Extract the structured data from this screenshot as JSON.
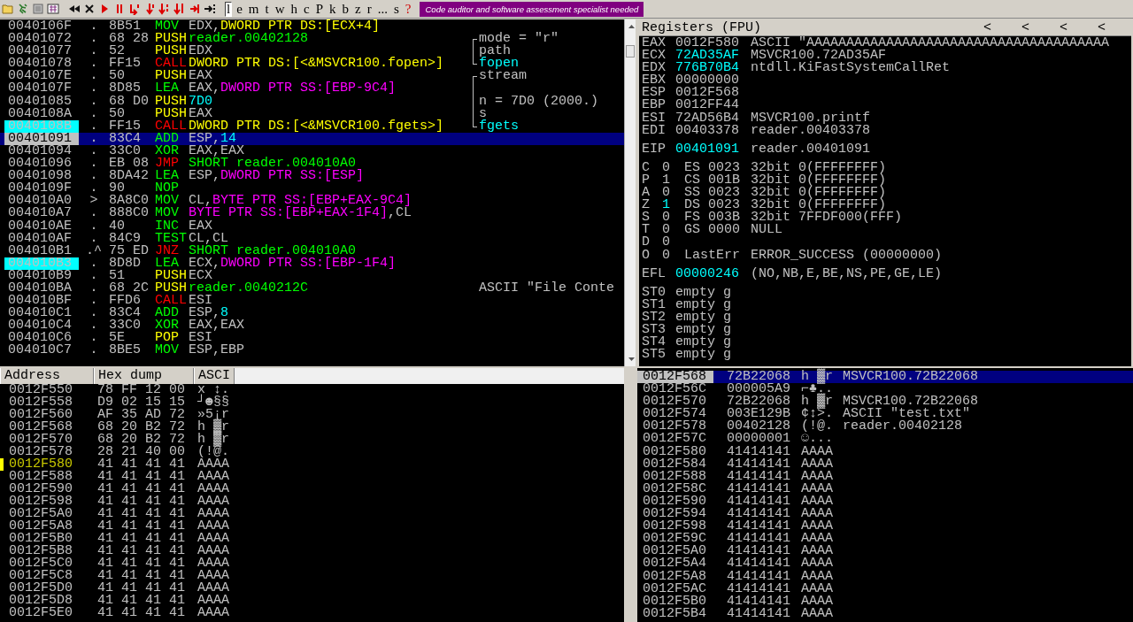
{
  "toolbar": {
    "window_buttons": [
      {
        "label": "l",
        "selected": true
      },
      {
        "label": "e",
        "selected": false
      },
      {
        "label": "m",
        "selected": false
      },
      {
        "label": "t",
        "selected": false
      },
      {
        "label": "w",
        "selected": false
      },
      {
        "label": "h",
        "selected": false
      },
      {
        "label": "c",
        "selected": false
      },
      {
        "label": "P",
        "selected": false
      },
      {
        "label": "k",
        "selected": false
      },
      {
        "label": "b",
        "selected": false
      },
      {
        "label": "z",
        "selected": false
      },
      {
        "label": "r",
        "selected": false
      },
      {
        "label": "...",
        "selected": false
      },
      {
        "label": "s",
        "selected": false
      }
    ],
    "help_button": "?",
    "banner": "Code auditor and software assessment specialist needed"
  },
  "disassembly": {
    "rows": [
      {
        "address": "0040106F",
        "mark": ".",
        "bytes": "8B51",
        "mnemonic": "MOV",
        "kind": "data",
        "operands": [
          {
            "text": "EDX,",
            "kind": "plain"
          },
          {
            "text": "DWORD PTR DS:[ECX+4]",
            "kind": "ds"
          }
        ],
        "marked": false,
        "selected": false
      },
      {
        "address": "00401072",
        "mark": ".",
        "bytes": "68 28",
        "mnemonic": "PUSH",
        "kind": "stack",
        "operands": [
          {
            "text": "reader.00402128",
            "kind": "addr"
          }
        ],
        "comment": {
          "text": "mode = \"r\"",
          "kind": "first_arg"
        },
        "marked": false,
        "selected": false
      },
      {
        "address": "00401077",
        "mark": ".",
        "bytes": "52",
        "mnemonic": "PUSH",
        "kind": "stack",
        "operands": [
          {
            "text": "EDX",
            "kind": "plain"
          }
        ],
        "comment": {
          "text": "path",
          "kind": "arg"
        },
        "marked": false,
        "selected": false
      },
      {
        "address": "00401078",
        "mark": ".",
        "bytes": "FF15",
        "mnemonic": "CALL",
        "kind": "flow",
        "operands": [
          {
            "text": "DWORD PTR DS:[<&MSVCR100.fopen>]",
            "kind": "ds"
          }
        ],
        "comment": {
          "text": "fopen",
          "kind": "call"
        },
        "marked": false,
        "selected": false
      },
      {
        "address": "0040107E",
        "mark": ".",
        "bytes": "50",
        "mnemonic": "PUSH",
        "kind": "stack",
        "operands": [
          {
            "text": "EAX",
            "kind": "plain"
          }
        ],
        "comment": {
          "text": "stream",
          "kind": "first_arg"
        },
        "marked": false,
        "selected": false
      },
      {
        "address": "0040107F",
        "mark": ".",
        "bytes": "8D85",
        "mnemonic": "LEA",
        "kind": "data",
        "operands": [
          {
            "text": "EAX,",
            "kind": "plain"
          },
          {
            "text": "DWORD PTR SS:[EBP-9C4]",
            "kind": "ss"
          }
        ],
        "comment": {
          "kind": "arg"
        },
        "marked": false,
        "selected": false
      },
      {
        "address": "00401085",
        "mark": ".",
        "bytes": "68 D0",
        "mnemonic": "PUSH",
        "kind": "stack",
        "operands": [
          {
            "text": "7D0",
            "kind": "num"
          }
        ],
        "comment": {
          "text": "n = 7D0 (2000.)",
          "kind": "arg"
        },
        "marked": false,
        "selected": false
      },
      {
        "address": "0040108A",
        "mark": ".",
        "bytes": "50",
        "mnemonic": "PUSH",
        "kind": "stack",
        "operands": [
          {
            "text": "EAX",
            "kind": "plain"
          }
        ],
        "comment": {
          "text": "s",
          "kind": "arg"
        },
        "marked": false,
        "selected": false
      },
      {
        "address": "0040108B",
        "mark": ".",
        "bytes": "FF15",
        "mnemonic": "CALL",
        "kind": "flow",
        "operands": [
          {
            "text": "DWORD PTR DS:[<&MSVCR100.fgets>]",
            "kind": "ds"
          }
        ],
        "comment": {
          "text": "fgets",
          "kind": "call"
        },
        "marked": true,
        "selected": false
      },
      {
        "address": "00401091",
        "mark": ".",
        "bytes": "83C4",
        "mnemonic": "ADD",
        "kind": "data",
        "operands": [
          {
            "text": "ESP,",
            "kind": "plain"
          },
          {
            "text": "14",
            "kind": "num"
          }
        ],
        "marked": false,
        "selected": true
      },
      {
        "address": "00401094",
        "mark": ".",
        "bytes": "33C0",
        "mnemonic": "XOR",
        "kind": "data",
        "operands": [
          {
            "text": "EAX,EAX",
            "kind": "plain"
          }
        ],
        "marked": false,
        "selected": false
      },
      {
        "address": "00401096",
        "mark": ".",
        "bytes": "EB 08",
        "mnemonic": "JMP",
        "kind": "flow",
        "operands": [
          {
            "text": "SHORT reader.004010A0",
            "kind": "addr"
          }
        ],
        "marked": false,
        "selected": false
      },
      {
        "address": "00401098",
        "mark": ".",
        "bytes": "8DA42",
        "mnemonic": "LEA",
        "kind": "data",
        "operands": [
          {
            "text": "ESP,",
            "kind": "plain"
          },
          {
            "text": "DWORD PTR SS:[ESP]",
            "kind": "ss"
          }
        ],
        "marked": false,
        "selected": false
      },
      {
        "address": "0040109F",
        "mark": ".",
        "bytes": "90",
        "mnemonic": "NOP",
        "kind": "data",
        "operands": [],
        "marked": false,
        "selected": false
      },
      {
        "address": "004010A0",
        "mark": ">",
        "bytes": "8A8C0",
        "mnemonic": "MOV",
        "kind": "data",
        "operands": [
          {
            "text": "CL,",
            "kind": "plain"
          },
          {
            "text": "BYTE PTR SS:[EBP+EAX-9C4]",
            "kind": "ss"
          }
        ],
        "marked": false,
        "selected": false
      },
      {
        "address": "004010A7",
        "mark": ".",
        "bytes": "888C0",
        "mnemonic": "MOV",
        "kind": "data",
        "operands": [
          {
            "text": "BYTE PTR SS:[EBP+EAX-1F4]",
            "kind": "ss"
          },
          {
            "text": ",CL",
            "kind": "plain"
          }
        ],
        "marked": false,
        "selected": false
      },
      {
        "address": "004010AE",
        "mark": ".",
        "bytes": "40",
        "mnemonic": "INC",
        "kind": "data",
        "operands": [
          {
            "text": "EAX",
            "kind": "plain"
          }
        ],
        "marked": false,
        "selected": false
      },
      {
        "address": "004010AF",
        "mark": ".",
        "bytes": "84C9",
        "mnemonic": "TEST",
        "kind": "data",
        "operands": [
          {
            "text": "CL,CL",
            "kind": "plain"
          }
        ],
        "marked": false,
        "selected": false
      },
      {
        "address": "004010B1",
        "mark": ".^",
        "bytes": "75 ED",
        "mnemonic": "JNZ",
        "kind": "flow",
        "operands": [
          {
            "text": "SHORT reader.004010A0",
            "kind": "addr"
          }
        ],
        "marked": false,
        "selected": false
      },
      {
        "address": "004010B3",
        "mark": ".",
        "bytes": "8D8D",
        "mnemonic": "LEA",
        "kind": "data",
        "operands": [
          {
            "text": "ECX,",
            "kind": "plain"
          },
          {
            "text": "DWORD PTR SS:[EBP-1F4]",
            "kind": "ss"
          }
        ],
        "marked": true,
        "selected": false
      },
      {
        "address": "004010B9",
        "mark": ".",
        "bytes": "51",
        "mnemonic": "PUSH",
        "kind": "stack",
        "operands": [
          {
            "text": "ECX",
            "kind": "plain"
          }
        ],
        "marked": false,
        "selected": false
      },
      {
        "address": "004010BA",
        "mark": ".",
        "bytes": "68 2C",
        "mnemonic": "PUSH",
        "kind": "stack",
        "operands": [
          {
            "text": "reader.0040212C",
            "kind": "addr"
          }
        ],
        "comment": {
          "text": "ASCII \"File Conte",
          "kind": "note"
        },
        "marked": false,
        "selected": false
      },
      {
        "address": "004010BF",
        "mark": ".",
        "bytes": "FFD6",
        "mnemonic": "CALL",
        "kind": "flow",
        "operands": [
          {
            "text": "ESI",
            "kind": "plain"
          }
        ],
        "marked": false,
        "selected": false
      },
      {
        "address": "004010C1",
        "mark": ".",
        "bytes": "83C4",
        "mnemonic": "ADD",
        "kind": "data",
        "operands": [
          {
            "text": "ESP,",
            "kind": "plain"
          },
          {
            "text": "8",
            "kind": "num"
          }
        ],
        "marked": false,
        "selected": false
      },
      {
        "address": "004010C4",
        "mark": ".",
        "bytes": "33C0",
        "mnemonic": "XOR",
        "kind": "data",
        "operands": [
          {
            "text": "EAX,EAX",
            "kind": "plain"
          }
        ],
        "marked": false,
        "selected": false
      },
      {
        "address": "004010C6",
        "mark": ".",
        "bytes": "5E",
        "mnemonic": "POP",
        "kind": "stack",
        "operands": [
          {
            "text": "ESI",
            "kind": "plain"
          }
        ],
        "marked": false,
        "selected": false
      },
      {
        "address": "004010C7",
        "mark": ".",
        "bytes": "8BE5",
        "mnemonic": "MOV",
        "kind": "data",
        "operands": [
          {
            "text": "ESP,EBP",
            "kind": "plain"
          }
        ],
        "marked": false,
        "selected": false
      }
    ]
  },
  "registers": {
    "title": "Registers (FPU)",
    "nav_buttons": [
      "<",
      "<",
      "<",
      "<"
    ],
    "general": [
      {
        "name": "EAX",
        "value": "0012F580",
        "changed": false,
        "comment": "ASCII \"AAAAAAAAAAAAAAAAAAAAAAAAAAAAAAAAAAAAAA"
      },
      {
        "name": "ECX",
        "value": "72AD35AF",
        "changed": true,
        "comment": "MSVCR100.72AD35AF"
      },
      {
        "name": "EDX",
        "value": "776B70B4",
        "changed": true,
        "comment": "ntdll.KiFastSystemCallRet"
      },
      {
        "name": "EBX",
        "value": "00000000",
        "changed": false
      },
      {
        "name": "ESP",
        "value": "0012F568",
        "changed": false
      },
      {
        "name": "EBP",
        "value": "0012FF44",
        "changed": false
      },
      {
        "name": "ESI",
        "value": "72AD56B4",
        "changed": false,
        "comment": "MSVCR100.printf"
      },
      {
        "name": "EDI",
        "value": "00403378",
        "changed": false,
        "comment": "reader.00403378"
      }
    ],
    "eip": {
      "name": "EIP",
      "value": "00401091",
      "changed": true,
      "comment": "reader.00401091"
    },
    "flags": [
      {
        "flag": "C",
        "value": "0",
        "changed": false,
        "segment": "ES 0023",
        "info": "32bit 0(FFFFFFFF)"
      },
      {
        "flag": "P",
        "value": "1",
        "changed": false,
        "segment": "CS 001B",
        "info": "32bit 0(FFFFFFFF)"
      },
      {
        "flag": "A",
        "value": "0",
        "changed": false,
        "segment": "SS 0023",
        "info": "32bit 0(FFFFFFFF)"
      },
      {
        "flag": "Z",
        "value": "1",
        "changed": true,
        "segment": "DS 0023",
        "info": "32bit 0(FFFFFFFF)"
      },
      {
        "flag": "S",
        "value": "0",
        "changed": false,
        "segment": "FS 003B",
        "info": "32bit 7FFDF000(FFF)"
      },
      {
        "flag": "T",
        "value": "0",
        "changed": false,
        "segment": "GS 0000",
        "info": "NULL"
      },
      {
        "flag": "D",
        "value": "0",
        "changed": false
      },
      {
        "flag": "O",
        "value": "0",
        "changed": false,
        "segment": "LastErr",
        "info": "ERROR_SUCCESS (00000000)"
      }
    ],
    "efl": {
      "name": "EFL",
      "value": "00000246",
      "changed": true,
      "comment": "(NO,NB,E,BE,NS,PE,GE,LE)"
    },
    "fpu": [
      {
        "name": "ST0",
        "value": "empty g"
      },
      {
        "name": "ST1",
        "value": "empty g"
      },
      {
        "name": "ST2",
        "value": "empty g"
      },
      {
        "name": "ST3",
        "value": "empty g"
      },
      {
        "name": "ST4",
        "value": "empty g"
      },
      {
        "name": "ST5",
        "value": "empty g"
      }
    ]
  },
  "dump": {
    "columns": [
      "Address",
      "Hex dump",
      "ASCI"
    ],
    "rows": [
      {
        "address": "0012F550",
        "hex": "78 FF 12 00",
        "ascii": "x ↕.",
        "marked": false
      },
      {
        "address": "0012F558",
        "hex": "D9 02 15 15",
        "ascii": "┘☻§§",
        "marked": false
      },
      {
        "address": "0012F560",
        "hex": "AF 35 AD 72",
        "ascii": "»5¡r",
        "marked": false
      },
      {
        "address": "0012F568",
        "hex": "68 20 B2 72",
        "ascii": "h ▓r",
        "marked": false
      },
      {
        "address": "0012F570",
        "hex": "68 20 B2 72",
        "ascii": "h ▓r",
        "marked": false
      },
      {
        "address": "0012F578",
        "hex": "28 21 40 00",
        "ascii": "(!@.",
        "marked": false
      },
      {
        "address": "0012F580",
        "hex": "41 41 41 41",
        "ascii": "AAAA",
        "marked": true
      },
      {
        "address": "0012F588",
        "hex": "41 41 41 41",
        "ascii": "AAAA",
        "marked": false
      },
      {
        "address": "0012F590",
        "hex": "41 41 41 41",
        "ascii": "AAAA",
        "marked": false
      },
      {
        "address": "0012F598",
        "hex": "41 41 41 41",
        "ascii": "AAAA",
        "marked": false
      },
      {
        "address": "0012F5A0",
        "hex": "41 41 41 41",
        "ascii": "AAAA",
        "marked": false
      },
      {
        "address": "0012F5A8",
        "hex": "41 41 41 41",
        "ascii": "AAAA",
        "marked": false
      },
      {
        "address": "0012F5B0",
        "hex": "41 41 41 41",
        "ascii": "AAAA",
        "marked": false
      },
      {
        "address": "0012F5B8",
        "hex": "41 41 41 41",
        "ascii": "AAAA",
        "marked": false
      },
      {
        "address": "0012F5C0",
        "hex": "41 41 41 41",
        "ascii": "AAAA",
        "marked": false
      },
      {
        "address": "0012F5C8",
        "hex": "41 41 41 41",
        "ascii": "AAAA",
        "marked": false
      },
      {
        "address": "0012F5D0",
        "hex": "41 41 41 41",
        "ascii": "AAAA",
        "marked": false
      },
      {
        "address": "0012F5D8",
        "hex": "41 41 41 41",
        "ascii": "AAAA",
        "marked": false
      },
      {
        "address": "0012F5E0",
        "hex": "41 41 41 41",
        "ascii": "AAAA",
        "marked": false
      }
    ]
  },
  "stack": {
    "rows": [
      {
        "address": "0012F568",
        "value": "72B22068",
        "ascii": "h ▓r",
        "comment": "MSVCR100.72B22068",
        "selected": true
      },
      {
        "address": "0012F56C",
        "value": "000005A9",
        "ascii": "⌐♣..",
        "selected": false
      },
      {
        "address": "0012F570",
        "value": "72B22068",
        "ascii": "h ▓r",
        "comment": "MSVCR100.72B22068",
        "selected": false
      },
      {
        "address": "0012F574",
        "value": "003E129B",
        "ascii": "¢↕>.",
        "comment": "ASCII \"test.txt\"",
        "selected": false
      },
      {
        "address": "0012F578",
        "value": "00402128",
        "ascii": "(!@.",
        "comment": "reader.00402128",
        "selected": false
      },
      {
        "address": "0012F57C",
        "value": "00000001",
        "ascii": "☺...",
        "selected": false
      },
      {
        "address": "0012F580",
        "value": "41414141",
        "ascii": "AAAA",
        "selected": false
      },
      {
        "address": "0012F584",
        "value": "41414141",
        "ascii": "AAAA",
        "selected": false
      },
      {
        "address": "0012F588",
        "value": "41414141",
        "ascii": "AAAA",
        "selected": false
      },
      {
        "address": "0012F58C",
        "value": "41414141",
        "ascii": "AAAA",
        "selected": false
      },
      {
        "address": "0012F590",
        "value": "41414141",
        "ascii": "AAAA",
        "selected": false
      },
      {
        "address": "0012F594",
        "value": "41414141",
        "ascii": "AAAA",
        "selected": false
      },
      {
        "address": "0012F598",
        "value": "41414141",
        "ascii": "AAAA",
        "selected": false
      },
      {
        "address": "0012F59C",
        "value": "41414141",
        "ascii": "AAAA",
        "selected": false
      },
      {
        "address": "0012F5A0",
        "value": "41414141",
        "ascii": "AAAA",
        "selected": false
      },
      {
        "address": "0012F5A4",
        "value": "41414141",
        "ascii": "AAAA",
        "selected": false
      },
      {
        "address": "0012F5A8",
        "value": "41414141",
        "ascii": "AAAA",
        "selected": false
      },
      {
        "address": "0012F5AC",
        "value": "41414141",
        "ascii": "AAAA",
        "selected": false
      },
      {
        "address": "0012F5B0",
        "value": "41414141",
        "ascii": "AAAA",
        "selected": false
      },
      {
        "address": "0012F5B4",
        "value": "41414141",
        "ascii": "AAAA",
        "selected": false
      }
    ]
  }
}
